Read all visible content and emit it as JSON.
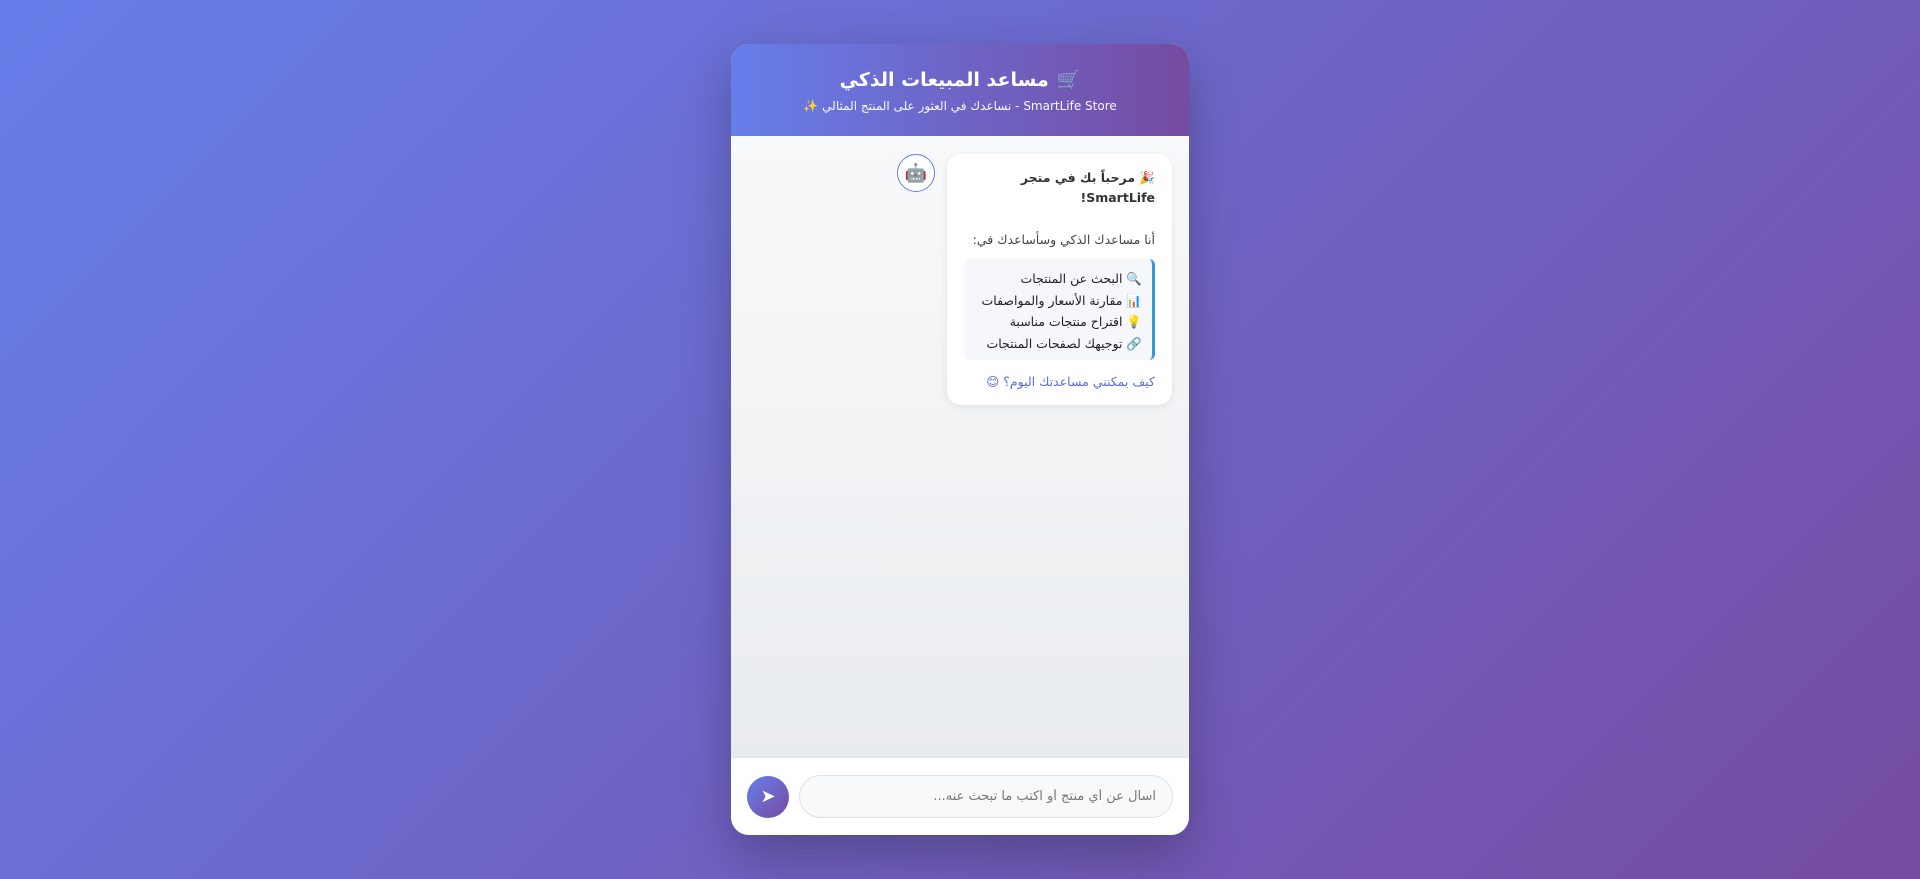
{
  "header": {
    "title": "مساعد المبيعات الذكي",
    "title_icon": "🛒",
    "subtitle": "SmartLife Store - نساعدك في العثور على المنتج المثالي",
    "subtitle_icon": "✨"
  },
  "welcome_message": {
    "avatar": "🤖",
    "greeting_icon": "🎉",
    "greeting": "مرحباً بك في متجر SmartLife!",
    "intro": "أنا مساعدك الذكي وسأساعدك في:",
    "features": [
      "🔍 البحث عن المنتجات",
      "📊 مقارنة الأسعار والمواصفات",
      "💡 اقتراح منتجات مناسبة",
      "🔗 توجيهك لصفحات المنتجات"
    ],
    "question": "كيف يمكنني مساعدتك اليوم؟ 😊"
  },
  "input": {
    "placeholder": "اسأل عن أي منتج أو اكتب ما تبحث عنه...",
    "value": "",
    "send_icon": "➤"
  },
  "colors": {
    "accent_start": "#667eea",
    "accent_end": "#764ba2",
    "feature_border": "#3498db",
    "question_text": "#5b6fd8"
  }
}
